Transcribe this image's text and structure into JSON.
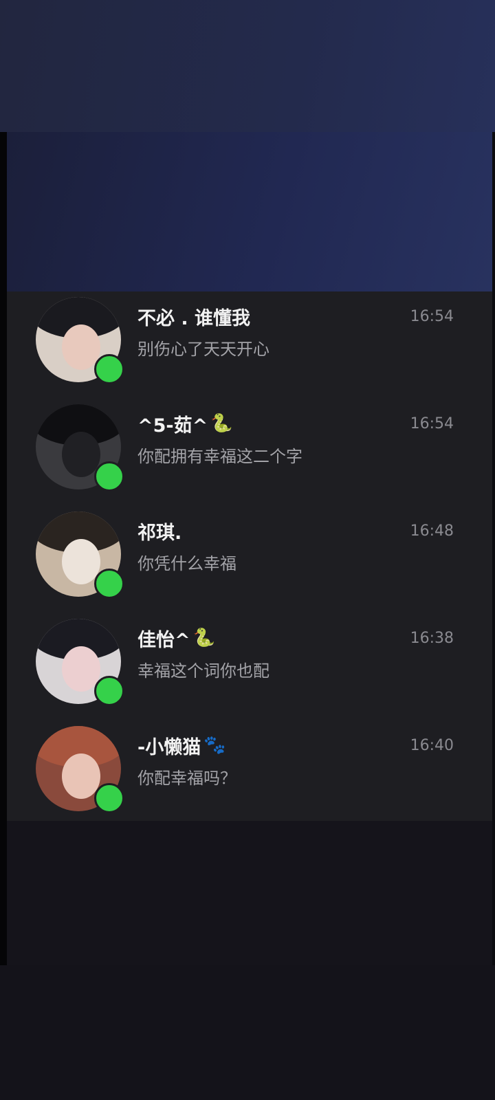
{
  "chats": [
    {
      "name": "不必 . 谁懂我",
      "emoji": "",
      "emoji_kind": "",
      "time": "16:54",
      "message": "别伤心了天天开心",
      "avatar_colors": {
        "bg": "#d9cfc6",
        "hair": "#1a1a1f",
        "face": "#e8c9bd"
      }
    },
    {
      "name": "^5-茹^",
      "emoji": "🐍",
      "emoji_kind": "snake",
      "time": "16:54",
      "message": "你配拥有幸福这二个字",
      "avatar_colors": {
        "bg": "#3a3a3e",
        "hair": "#0f0f12",
        "face": "#202024"
      }
    },
    {
      "name": "祁琪.",
      "emoji": "",
      "emoji_kind": "",
      "time": "16:48",
      "message": "你凭什么幸福",
      "avatar_colors": {
        "bg": "#c8b7a4",
        "hair": "#2a2420",
        "face": "#ece3da"
      }
    },
    {
      "name": "佳怡^",
      "emoji": "🐍",
      "emoji_kind": "snake",
      "time": "16:38",
      "message": "幸福这个词你也配",
      "avatar_colors": {
        "bg": "#d8d4d6",
        "hair": "#1b1b22",
        "face": "#eccfd0"
      }
    },
    {
      "name": "-小懒猫",
      "emoji": "🐾",
      "emoji_kind": "paw",
      "time": "16:40",
      "message": "你配幸福吗？",
      "avatar_colors": {
        "bg": "#8a4a3c",
        "hair": "#a8553e",
        "face": "#e9c4b6"
      }
    }
  ]
}
